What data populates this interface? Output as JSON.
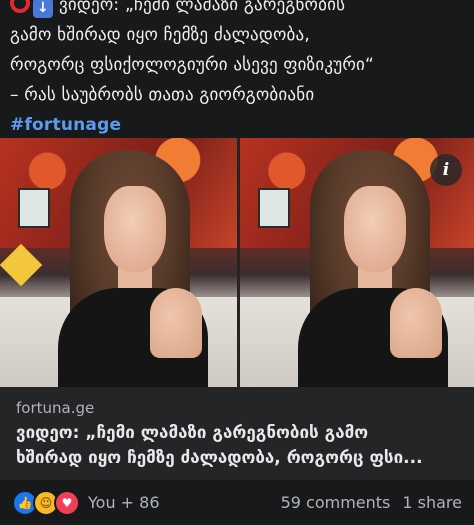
{
  "post": {
    "text_lines": [
      "ვიდეო: „ჩემი ლამაზი გარეგნობის",
      "გამო ხშირად იყო ჩემზე ძალადობა,",
      "როგორც ფსიქოლოგიური ასევე ფიზიკური“",
      "– რას საუბრობს თათა გიორგობიანი"
    ],
    "hashtag": "#fortunage",
    "emoji_1": "red-circle-icon",
    "emoji_2": "down-arrow-icon"
  },
  "media": {
    "info_badge": "i",
    "info_icon": "info-icon"
  },
  "link_preview": {
    "domain": "fortuna.ge",
    "title_lines": [
      "ვიდეო: „ჩემი ლამაზი გარეგნობის გამო",
      "ხშირად იყო ჩემზე ძალადობა, როგორც ფსი..."
    ]
  },
  "reactions": {
    "icons": [
      "like-icon",
      "haha-icon",
      "love-icon"
    ],
    "count_label": "You + 86",
    "comments_label": "59 comments",
    "shares_label": "1 share"
  },
  "colors": {
    "background": "#18191a",
    "card": "#242526",
    "hashtag": "#5e9bf0",
    "like": "#1877f2",
    "love": "#f33e58",
    "haha": "#f7b928"
  }
}
